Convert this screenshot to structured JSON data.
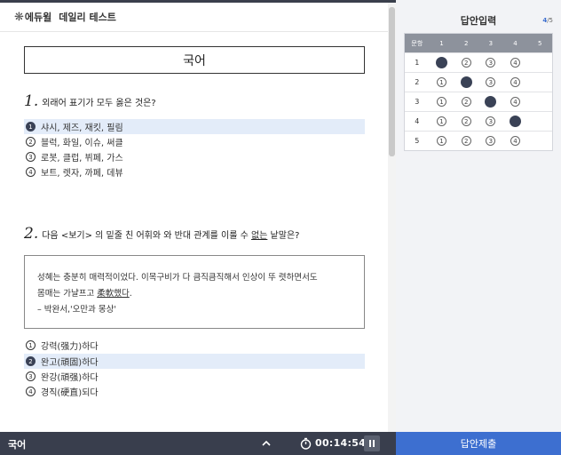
{
  "header": {
    "brand": "에듀윌",
    "title": "데일리 테스트"
  },
  "subject": "국어",
  "questions": [
    {
      "number": "1.",
      "text": "외래어 표기가 모두 옳은 것은?",
      "options": [
        {
          "num": "1",
          "text": "샤시, 제즈, 재킷, 필림",
          "selected": true
        },
        {
          "num": "2",
          "text": "블럭, 화일, 이슈, 써클",
          "selected": false
        },
        {
          "num": "3",
          "text": "로봇, 클럽, 뷔페, 가스",
          "selected": false
        },
        {
          "num": "4",
          "text": "보트, 렛자, 까페, 데뷰",
          "selected": false
        }
      ]
    },
    {
      "number": "2.",
      "text_before": "다음 <보기> 의 밑줄 친 어휘와 와 반대 관계를 이룰 수 ",
      "text_underline": "없는",
      "text_after": " 낱말은?",
      "passage": {
        "line1": "성혜는 충분히 매력적이었다. 이목구비가 다 큼직큼직해서 인상이 뚜 렷하면서도",
        "line2_before": "몸매는 가냘프고 ",
        "line2_underline": "柔軟했다",
        "line2_after": ".",
        "source": "– 박완서,'오만과 몽상'"
      },
      "options": [
        {
          "num": "1",
          "text": "강력(强力)하다",
          "selected": false
        },
        {
          "num": "2",
          "text": "완고(頑固)하다",
          "selected": true
        },
        {
          "num": "3",
          "text": "완강(頑强)하다",
          "selected": false
        },
        {
          "num": "4",
          "text": "경직(硬直)되다",
          "selected": false
        }
      ]
    }
  ],
  "bottom": {
    "subject": "국어",
    "timer": "00:14:54"
  },
  "answer_panel": {
    "title": "답안입력",
    "count_current": "4",
    "count_total": "/5",
    "headers": [
      "문항",
      "1",
      "2",
      "3",
      "4",
      "5"
    ],
    "rows": [
      {
        "q": "1",
        "choices": [
          "1",
          "2",
          "3",
          "4"
        ],
        "selected": 1
      },
      {
        "q": "2",
        "choices": [
          "1",
          "2",
          "3",
          "4"
        ],
        "selected": 2
      },
      {
        "q": "3",
        "choices": [
          "1",
          "2",
          "3",
          "4"
        ],
        "selected": 3
      },
      {
        "q": "4",
        "choices": [
          "1",
          "2",
          "3",
          "4"
        ],
        "selected": 4
      },
      {
        "q": "5",
        "choices": [
          "1",
          "2",
          "3",
          "4"
        ],
        "selected": 0
      }
    ]
  },
  "submit_label": "답안제출",
  "colors": {
    "dark_bar": "#393e4d",
    "accent": "#3d6fd0",
    "selected_row": "#e3ecf9",
    "filled_circle": "#3a4256"
  }
}
